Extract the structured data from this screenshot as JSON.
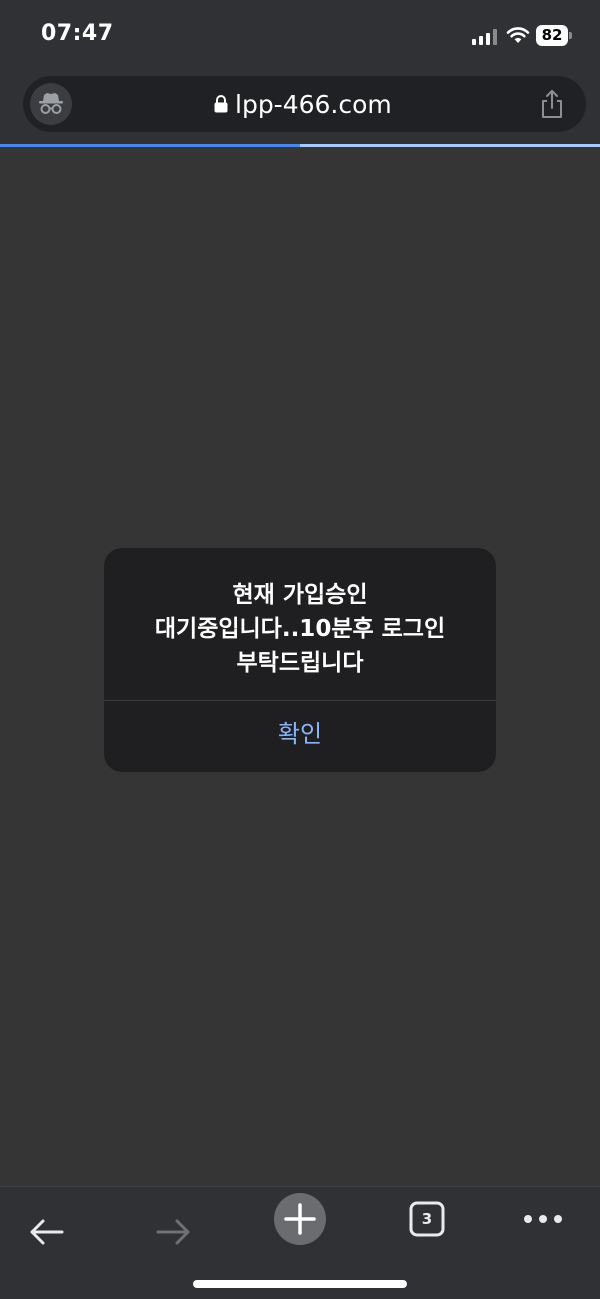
{
  "status_bar": {
    "time": "07:47",
    "battery": "82",
    "signal_icon": "cellular-signal-icon",
    "wifi_icon": "wifi-icon"
  },
  "browser": {
    "url": "lpp-466.com",
    "mode_icon": "incognito-icon",
    "secure_icon": "lock-icon",
    "share_icon": "share-icon",
    "load_progress": 0.5
  },
  "dialog": {
    "message": "현재 가입승인\n대기중입니다..10분후 로그인\n부탁드립니다",
    "confirm_label": "확인"
  },
  "toolbar": {
    "back_icon": "back-arrow-icon",
    "forward_icon": "forward-arrow-icon",
    "new_tab_icon": "plus-icon",
    "tab_count": "3",
    "menu_icon": "more-dots-icon"
  },
  "colors": {
    "page_background": "#353535",
    "chrome_background": "#303134",
    "accent": "#8ab4f8"
  }
}
